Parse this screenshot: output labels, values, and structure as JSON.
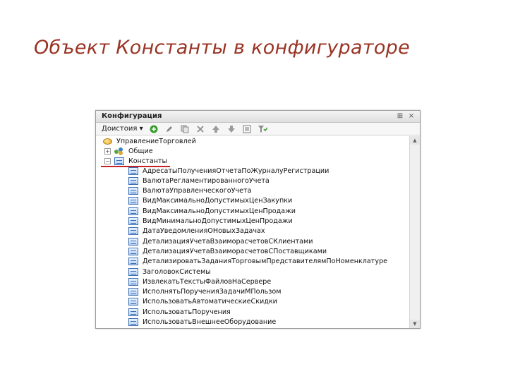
{
  "slide": {
    "title": "Объект Константы в конфигураторе"
  },
  "window": {
    "title": "Конфигурация",
    "pin_glyph": "⊞",
    "close_glyph": "×"
  },
  "toolbar": {
    "actions_label": "Доистоия ▾",
    "buttons": [
      "add-icon",
      "edit-icon",
      "copy-icon",
      "delete-icon",
      "move-up-icon",
      "move-down-icon",
      "properties-icon",
      "filter-icon"
    ]
  },
  "tree": {
    "root": "УправлениеТорговлей",
    "common": {
      "label": "Общие",
      "expander": "+"
    },
    "constants": {
      "label": "Константы",
      "expander": "−"
    },
    "items": [
      "АдресатыПолученияОтчетаПоЖурналуРегистрации",
      "ВалютаРегламентированногоУчета",
      "ВалютаУправленческогоУчета",
      "ВидМаксимальноДопустимыхЦенЗакупки",
      "ВидМаксимальноДопустимыхЦенПродажи",
      "ВидМинимальноДопустимыхЦенПродажи",
      "ДатаУведомленияОНовыхЗадачах",
      "ДетализацияУчетаВзаиморасчетовСКлиентами",
      "ДетализацияУчетаВзаиморасчетовСПоставщиками",
      "ДетализироватьЗаданияТорговымПредставителямПоНоменклатуре",
      "ЗаголовокСистемы",
      "ИзвлекатьТекстыФайловНаСервере",
      "ИсполнятьПорученияЗадачиМПользом",
      "ИспользоватьАвтоматическиеСкидки",
      "ИспользоватьПоручения",
      "ИспользоватьВнешнееОборудование"
    ]
  },
  "scrollbar": {
    "up": "▲",
    "down": "▼"
  }
}
